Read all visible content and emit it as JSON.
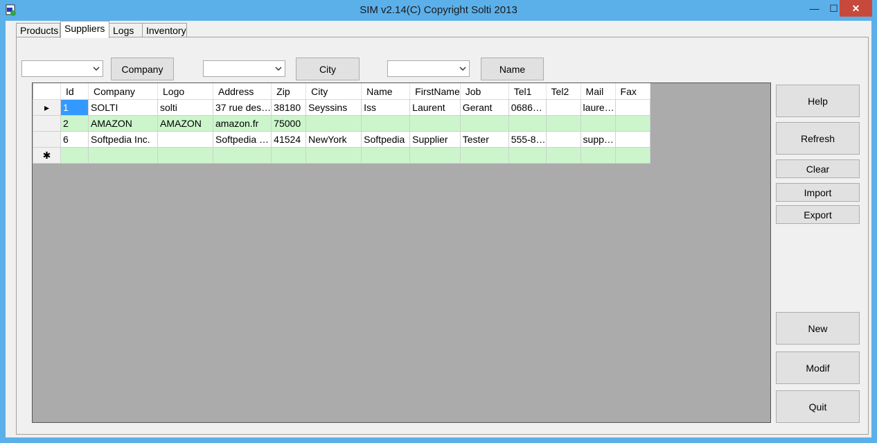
{
  "window": {
    "title": "SIM v2.14(C) Copyright Solti 2013",
    "min": "—",
    "max": "☐",
    "close": "✕"
  },
  "tabs": [
    {
      "label": "Products"
    },
    {
      "label": "Suppliers"
    },
    {
      "label": "Logs"
    },
    {
      "label": "Inventory"
    }
  ],
  "filters": {
    "company_button": "Company",
    "city_button": "City",
    "name_button": "Name"
  },
  "grid": {
    "columns": [
      "Id",
      "Company",
      "Logo",
      "Address",
      "Zip",
      "City",
      "Name",
      "FirstName",
      "Job",
      "Tel1",
      "Tel2",
      "Mail",
      "Fax"
    ],
    "rows": [
      {
        "marker": "▸",
        "cells": [
          "1",
          "SOLTI",
          "solti",
          "37 rue des…",
          "38180",
          "Seyssins",
          "Iss",
          "Laurent",
          "Gerant",
          "0686…",
          "",
          "laure…",
          ""
        ]
      },
      {
        "marker": "",
        "cells": [
          "2",
          "AMAZON",
          "AMAZON",
          "amazon.fr",
          "75000",
          "",
          "",
          "",
          "",
          "",
          "",
          "",
          ""
        ]
      },
      {
        "marker": "",
        "cells": [
          "6",
          "Softpedia Inc.",
          "",
          "Softpedia …",
          "41524",
          "NewYork",
          "Softpedia",
          "Supplier",
          "Tester",
          "555-8…",
          "",
          "supp…",
          ""
        ]
      },
      {
        "marker": "✱",
        "cells": [
          "",
          "",
          "",
          "",
          "",
          "",
          "",
          "",
          "",
          "",
          "",
          "",
          ""
        ]
      }
    ]
  },
  "buttons": {
    "help": "Help",
    "refresh": "Refresh",
    "clear": "Clear",
    "import": "Import",
    "export": "Export",
    "new": "New",
    "modif": "Modif",
    "quit": "Quit"
  }
}
